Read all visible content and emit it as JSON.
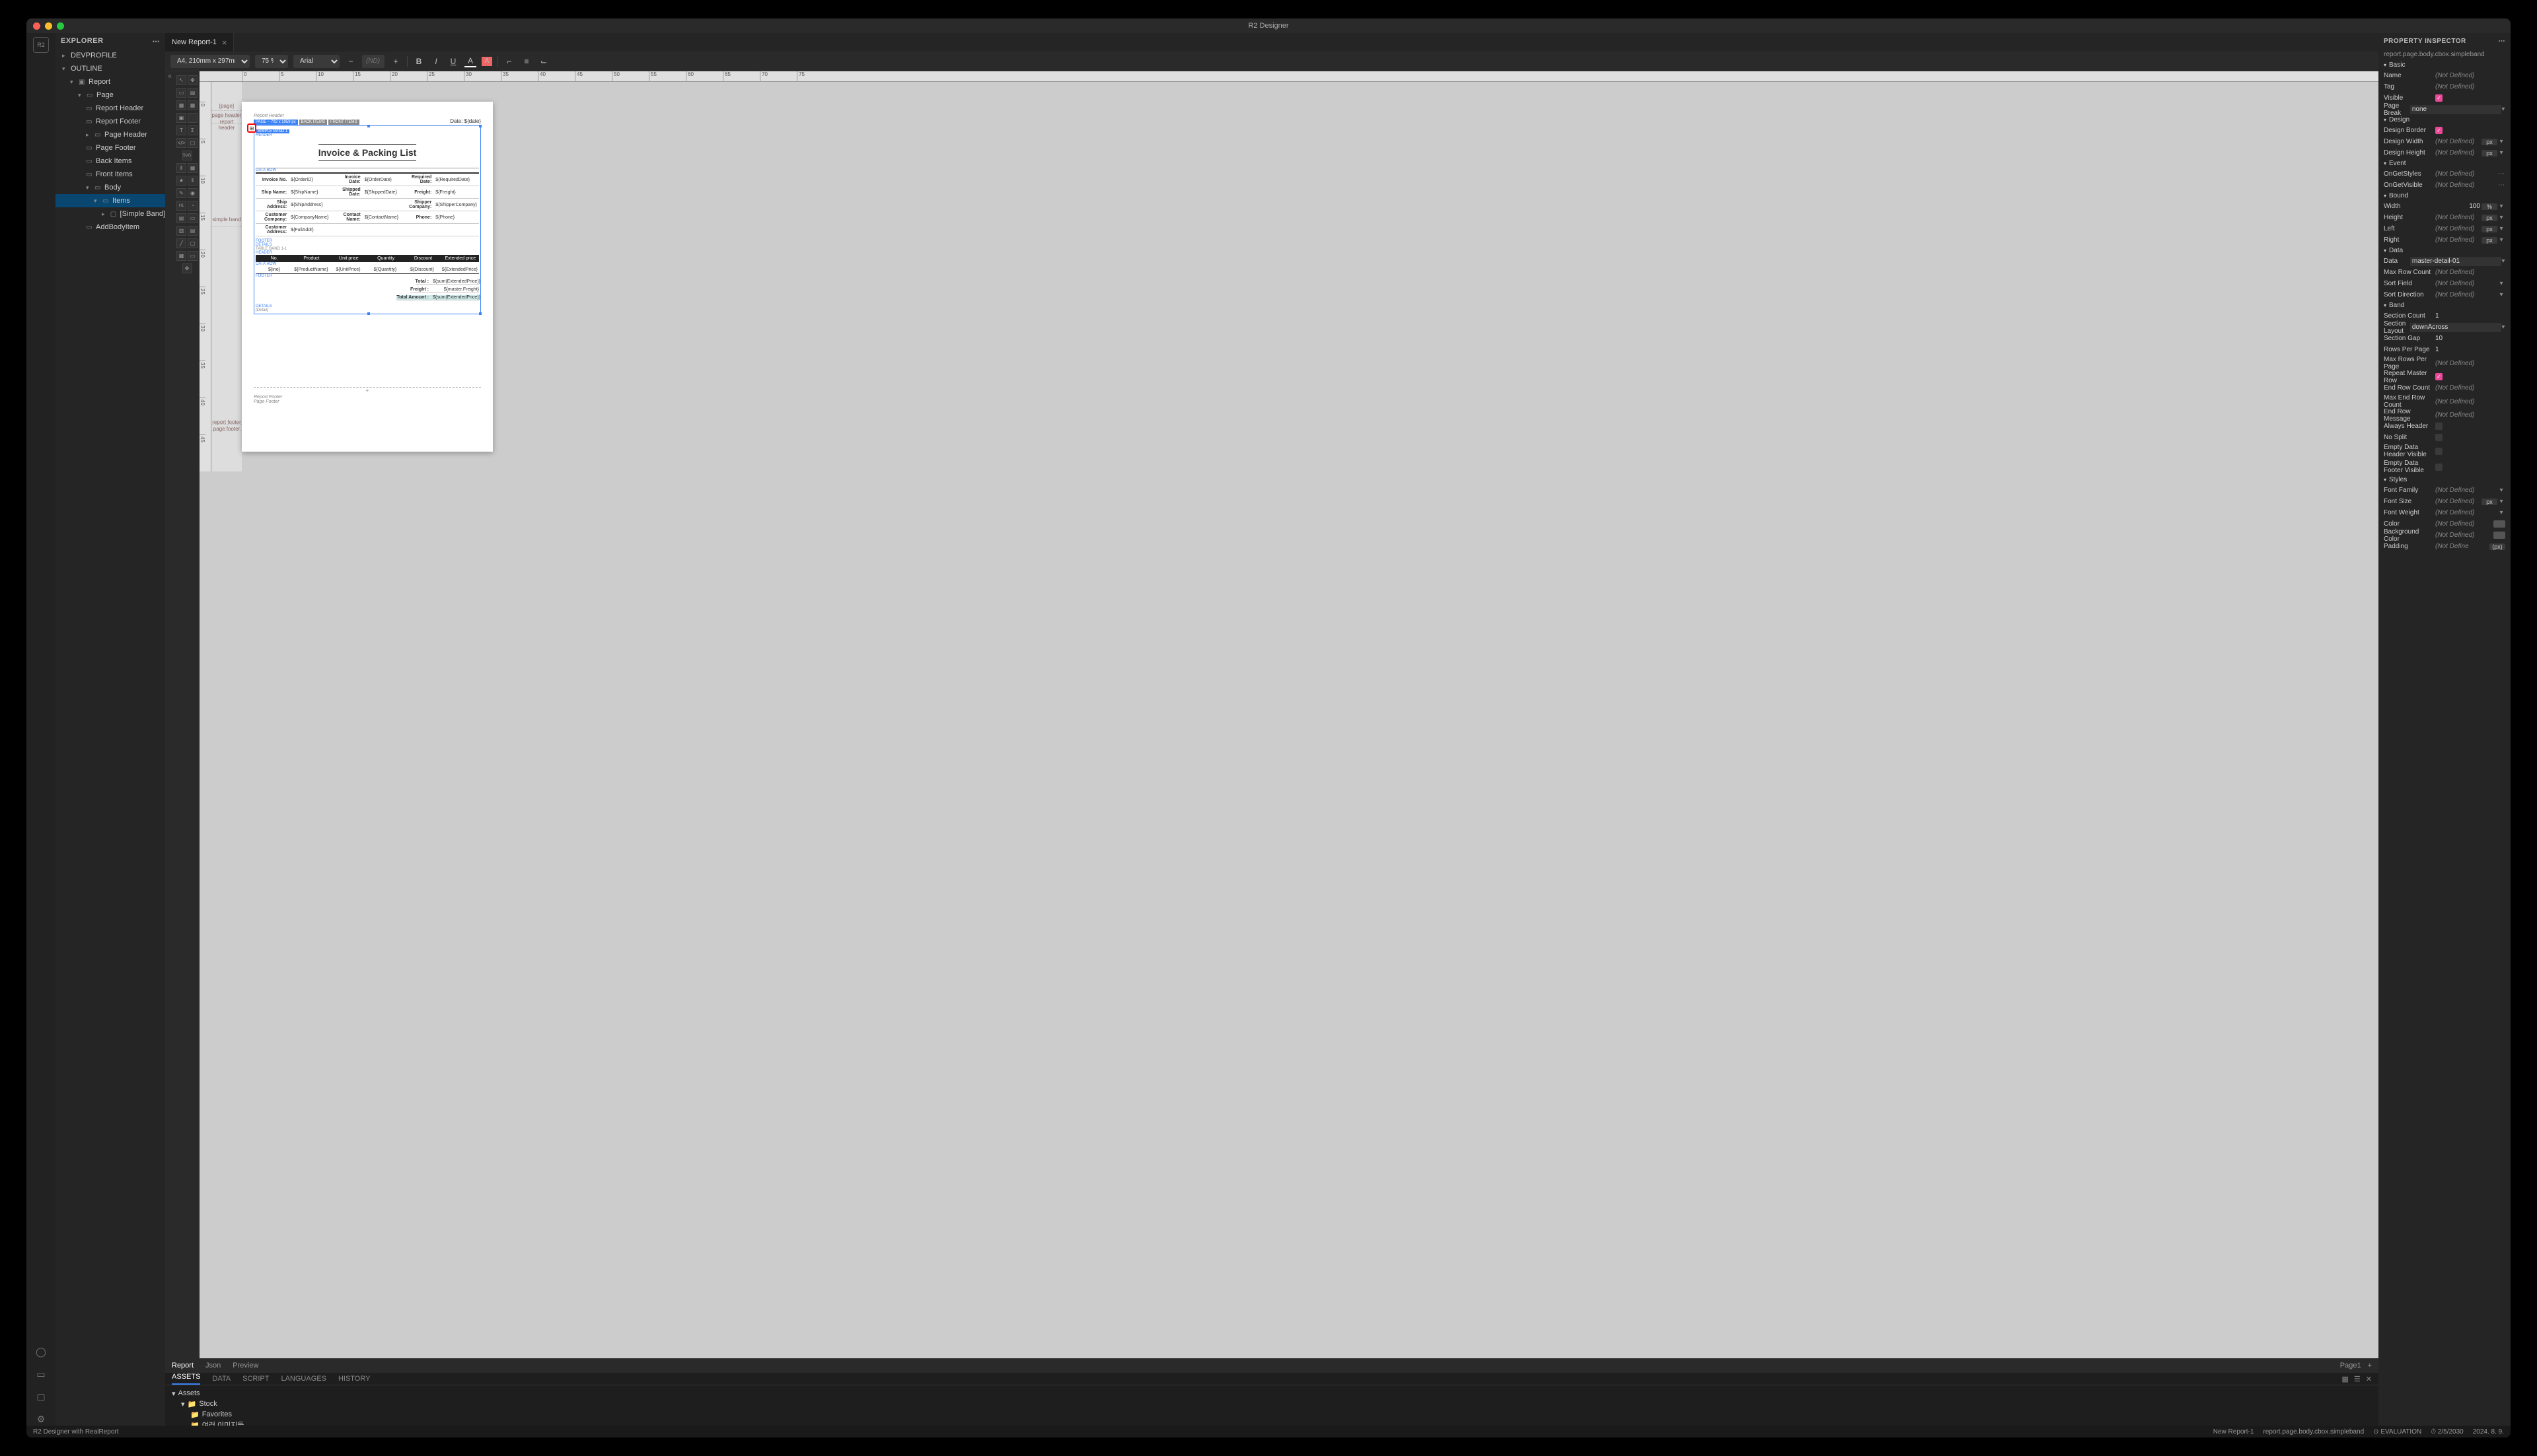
{
  "app_title": "R2 Designer",
  "explorer": {
    "title": "EXPLORER",
    "devprofile": "DEVPROFILE",
    "outline": "OUTLINE",
    "tree": {
      "report": "Report",
      "page": "Page",
      "report_header": "Report Header",
      "report_footer": "Report Footer",
      "page_header": "Page Header",
      "page_footer": "Page Footer",
      "back_items": "Back Items",
      "front_items": "Front Items",
      "body": "Body",
      "items": "Items",
      "simple_band": "[Simple Band]",
      "add_body_item": "AddBodyItem"
    }
  },
  "tab": {
    "name": "New Report-1"
  },
  "toolbar": {
    "page_size": "A4, 210mm x 297mm",
    "zoom": "75 %",
    "font": "Arial",
    "font_size_placeholder": "(ND)"
  },
  "ruler_ticks": [
    "0",
    "5",
    "10",
    "15",
    "20",
    "25",
    "30",
    "35",
    "40",
    "45",
    "50",
    "55",
    "60",
    "65",
    "70",
    "75"
  ],
  "gutter": {
    "page_lbl": "[page]",
    "page_header": "page header",
    "report_header": "report header",
    "simple_band": "simple band",
    "report_footer": "report footer",
    "page_footer": "page footer"
  },
  "report": {
    "rpt_hdr": "Report Header",
    "page_badge": "PAGE – 702 x 1059 px",
    "back_badge": "BACK ITEMS",
    "front_badge": "FRONT ITEMS",
    "date_label": "Date: ${date}",
    "simple_band_tag": "SIMPLE BAND 1",
    "header_lbl": "HEADER",
    "title": "Invoice & Packing List",
    "data_row": "DATA ROW",
    "fields": {
      "invoice_no": "Invoice No.",
      "invoice_no_v": "${OrderID}",
      "invoice_date": "Invoice Date:",
      "invoice_date_v": "${OrderDate}",
      "req_date": "Required Date:",
      "req_date_v": "${RequiredDate}",
      "ship_name": "Ship Name:",
      "ship_name_v": "${ShipName}",
      "shipped_date": "Shipped Date:",
      "shipped_date_v": "${ShippedDate}",
      "freight": "Freight:",
      "freight_v": "${Freight}",
      "ship_addr": "Ship Address:",
      "ship_addr_v": "${ShipAddress}",
      "shipper": "Shipper Company:",
      "shipper_v": "${ShipperCompany}",
      "cust_co": "Customer Company:",
      "cust_co_v": "${CompanyName}",
      "contact": "Contact Name:",
      "contact_v": "${ContactName}",
      "phone": "Phone:",
      "phone_v": "${Phone}",
      "cust_addr": "Customer Address:",
      "cust_addr_v": "${FullAddr}"
    },
    "footer_lbl": "FOOTER",
    "details_lbl": "DETAILS",
    "table_band": "TABLE BAND 1-1",
    "cols": {
      "no": "No.",
      "product": "Product",
      "unit": "Unit price",
      "qty": "Quantity",
      "disc": "Discount",
      "ext": "Extended price"
    },
    "row": {
      "no": "${ino}",
      "product": "${ProductName}",
      "unit": "${UnitPrice}",
      "qty": "${Quantity}",
      "disc": "${Discount}",
      "ext": "${ExtendedPrice}"
    },
    "totals": {
      "total": "Total :",
      "total_v": "${sum(ExtendedPrice)}",
      "freight": "Freight :",
      "freight_v": "${master.Freight}",
      "amount": "Total Amount :",
      "amount_v": "${sum(ExtendedPrice)}"
    },
    "detail_lbl": "[Detail]",
    "rpt_ftr": "Report Footer",
    "pg_ftr": "Page Footer"
  },
  "bottom_tabs": {
    "report": "Report",
    "json": "Json",
    "preview": "Preview",
    "page": "Page1"
  },
  "assets_tabs": {
    "assets": "ASSETS",
    "data": "DATA",
    "script": "SCRIPT",
    "languages": "LANGUAGES",
    "history": "HISTORY"
  },
  "assets_tree": {
    "assets": "Assets",
    "stock": "Stock",
    "favorites": "Favorites",
    "more": "여러 이미지들"
  },
  "inspector": {
    "title": "PROPERTY INSPECTOR",
    "path": "report.page.body.cbox.simpleband",
    "nd": "(Not Defined)",
    "sections": {
      "basic": "Basic",
      "design": "Design",
      "event": "Event",
      "bound": "Bound",
      "data": "Data",
      "band": "Band",
      "styles": "Styles"
    },
    "props": {
      "name": "Name",
      "tag": "Tag",
      "visible": "Visible",
      "page_break": "Page Break",
      "page_break_v": "none",
      "design_border": "Design Border",
      "design_width": "Design Width",
      "design_height": "Design Height",
      "onget_styles": "OnGetStyles",
      "onget_visible": "OnGetVisible",
      "width": "Width",
      "width_v": "100",
      "width_u": "%",
      "height": "Height",
      "left": "Left",
      "right": "Right",
      "data": "Data",
      "data_v": "master-detail-01",
      "max_row_count": "Max Row Count",
      "sort_field": "Sort Field",
      "sort_direction": "Sort Direction",
      "section_count": "Section Count",
      "section_count_v": "1",
      "section_layout": "Section Layout",
      "section_layout_v": "downAcross",
      "section_gap": "Section Gap",
      "section_gap_v": "10",
      "rows_per_page": "Rows Per Page",
      "rows_per_page_v": "1",
      "max_rows_per_page": "Max Rows Per Page",
      "repeat_master": "Repeat Master Row",
      "end_row_count": "End Row Count",
      "max_end_row": "Max End Row Count",
      "end_row_msg": "End Row Message",
      "always_header": "Always Header",
      "no_split": "No Split",
      "empty_hdr": "Empty Data Header Visible",
      "empty_ftr": "Empty Data Footer Visible",
      "font_family": "Font Family",
      "font_size": "Font Size",
      "font_weight": "Font Weight",
      "color": "Color",
      "bg_color": "Background Color",
      "padding": "Padding",
      "padding_v": "(Not Define",
      "padding_u": "(px)"
    }
  },
  "status": {
    "left": "R2 Designer with RealReport",
    "file": "New Report-1",
    "path": "report.page.body.cbox.simpleband",
    "eval": "EVALUATION",
    "time": "2/5/2030",
    "date": "2024. 8. 9."
  }
}
